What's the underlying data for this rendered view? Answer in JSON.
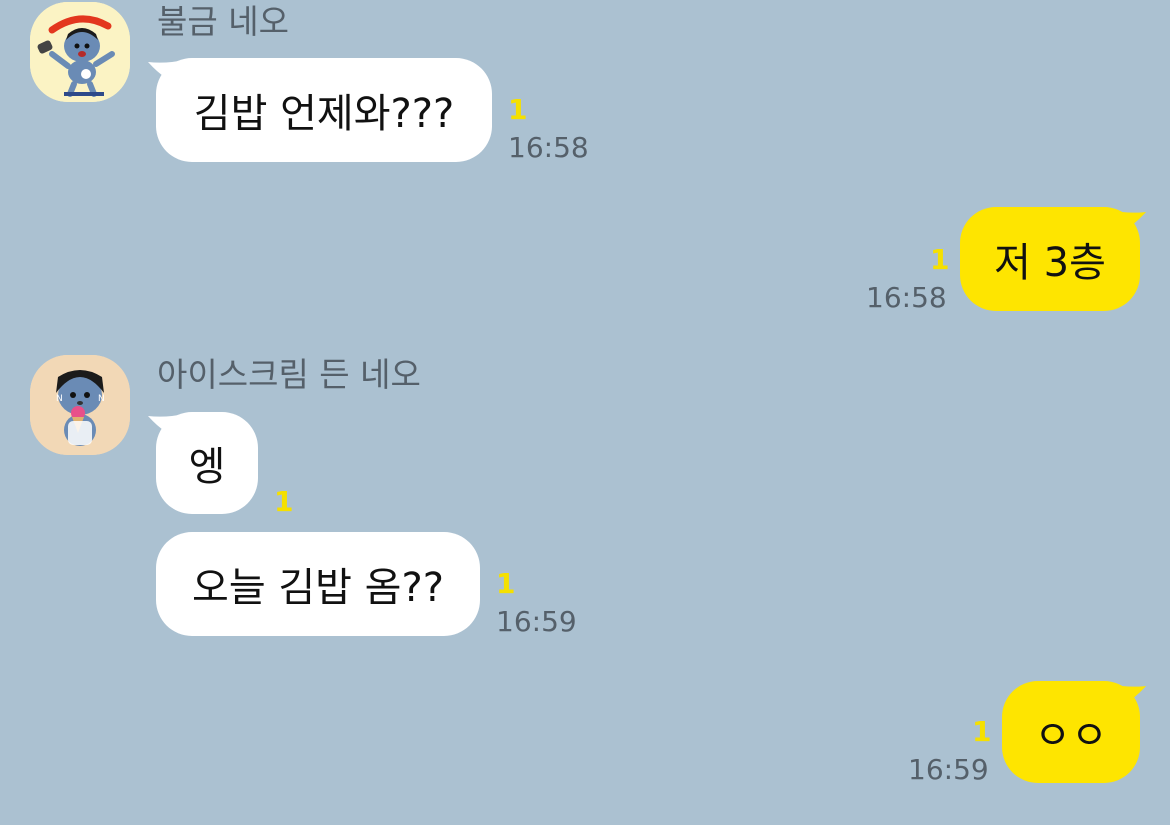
{
  "theme": {
    "background": "#abc1d1",
    "incoming_bubble": "#ffffff",
    "outgoing_bubble": "#fee500",
    "unread_color": "#f5e000"
  },
  "messages": [
    {
      "direction": "in",
      "sender": "불금 네오",
      "avatar": "neo-friday-avatar",
      "text": "김밥 언제와???",
      "unread": "1",
      "time": "16:58"
    },
    {
      "direction": "out",
      "text": "저 3층",
      "unread": "1",
      "time": "16:58"
    },
    {
      "direction": "in",
      "sender": "아이스크림 든 네오",
      "avatar": "neo-icecream-avatar",
      "text": "엥",
      "unread": "1",
      "time": ""
    },
    {
      "direction": "in",
      "text": "오늘 김밥 옴??",
      "unread": "1",
      "time": "16:59"
    },
    {
      "direction": "out",
      "text": "ㅇㅇ",
      "unread": "1",
      "time": "16:59"
    }
  ]
}
